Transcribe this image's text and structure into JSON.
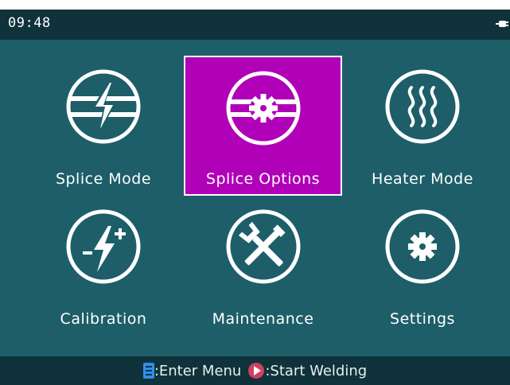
{
  "status_bar": {
    "time": "09:48",
    "power_icon": "plug-icon"
  },
  "menu": {
    "items": [
      {
        "label": "Splice Mode",
        "icon": "splice-mode-icon",
        "selected": false
      },
      {
        "label": "Splice Options",
        "icon": "splice-options-icon",
        "selected": true
      },
      {
        "label": "Heater Mode",
        "icon": "heater-mode-icon",
        "selected": false
      },
      {
        "label": "Calibration",
        "icon": "calibration-icon",
        "selected": false
      },
      {
        "label": "Maintenance",
        "icon": "maintenance-icon",
        "selected": false
      },
      {
        "label": "Settings",
        "icon": "settings-icon",
        "selected": false
      }
    ]
  },
  "footer": {
    "enter_key": ":Enter Menu",
    "start_key": ":Start Welding",
    "enter_icon": "menu-key-icon",
    "start_icon": "play-key-icon"
  },
  "colors": {
    "background": "#1d5e69",
    "bar": "#10323a",
    "selected": "#b000b8",
    "menu_key": "#2f8fe8",
    "start_key": "#d04060"
  }
}
